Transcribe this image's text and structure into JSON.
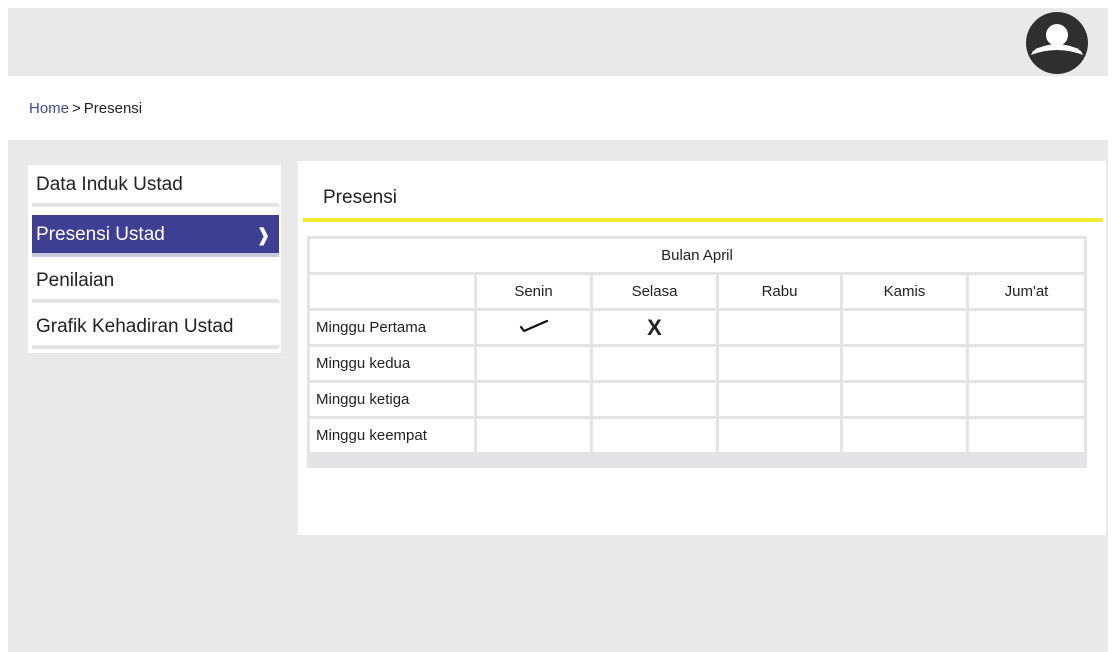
{
  "header": {
    "avatar_icon": "user-avatar-icon"
  },
  "breadcrumb": {
    "home": "Home",
    "separator": ">",
    "current": "Presensi"
  },
  "sidebar": {
    "items": [
      {
        "label": "Data Induk Ustad",
        "active": false
      },
      {
        "label": "Presensi Ustad",
        "active": true,
        "indicator": "❱"
      },
      {
        "label": "Penilaian",
        "active": false
      },
      {
        "label": "Grafik Kehadiran Ustad",
        "active": false
      }
    ]
  },
  "main": {
    "title": "Presensi",
    "accent_color": "#f2ea2c",
    "table": {
      "month_header": "Bulan April",
      "days": [
        "Senin",
        "Selasa",
        "Rabu",
        "Kamis",
        "Jum'at"
      ],
      "rows": [
        {
          "label": "Minggu Pertama",
          "cells": [
            "check-icon",
            "x-icon",
            "",
            "",
            ""
          ]
        },
        {
          "label": "Minggu kedua",
          "cells": [
            "",
            "",
            "",
            "",
            ""
          ]
        },
        {
          "label": "Minggu ketiga",
          "cells": [
            "",
            "",
            "",
            "",
            ""
          ]
        },
        {
          "label": "Minggu keempat",
          "cells": [
            "",
            "",
            "",
            "",
            ""
          ]
        }
      ],
      "x_mark": "X"
    }
  },
  "colors": {
    "active_nav": "#3e3f93",
    "background": "#e9e9ea",
    "link": "#3d4a8f"
  }
}
